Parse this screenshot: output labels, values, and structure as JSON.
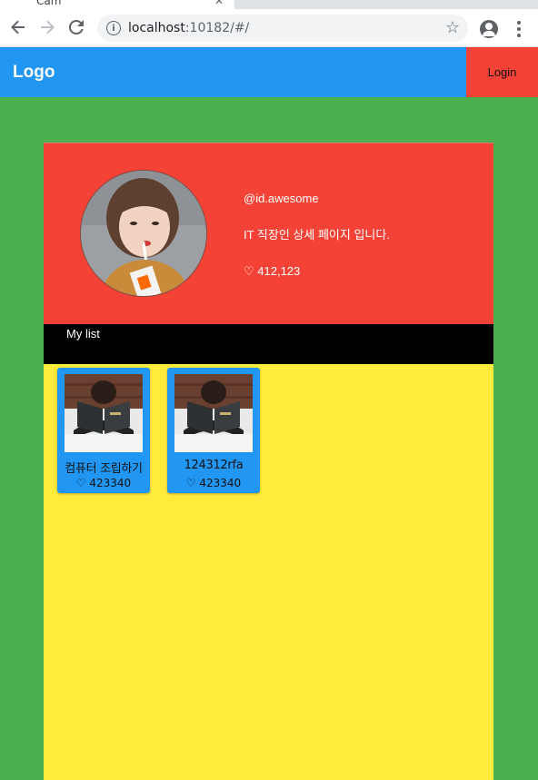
{
  "browser": {
    "tab_title": "Cam",
    "url_host": "localhost",
    "url_path": ":10182/#/"
  },
  "appbar": {
    "logo": "Logo",
    "login_label": "Login"
  },
  "profile": {
    "username": "@id.awesome",
    "description": "IT 직장인 상세 페이지 입니다.",
    "likes": "♡ 412,123"
  },
  "mylist": {
    "label": "My list",
    "items": [
      {
        "title": "컴퓨터 조립하기",
        "likes": "♡ 423340"
      },
      {
        "title": "124312rfa",
        "likes": "♡ 423340"
      }
    ]
  },
  "colors": {
    "page_bg": "#4caf50",
    "appbar": "#2196f3",
    "login": "#f44336",
    "header": "#f44336",
    "content": "#ffeb3b",
    "card": "#2196f3"
  }
}
